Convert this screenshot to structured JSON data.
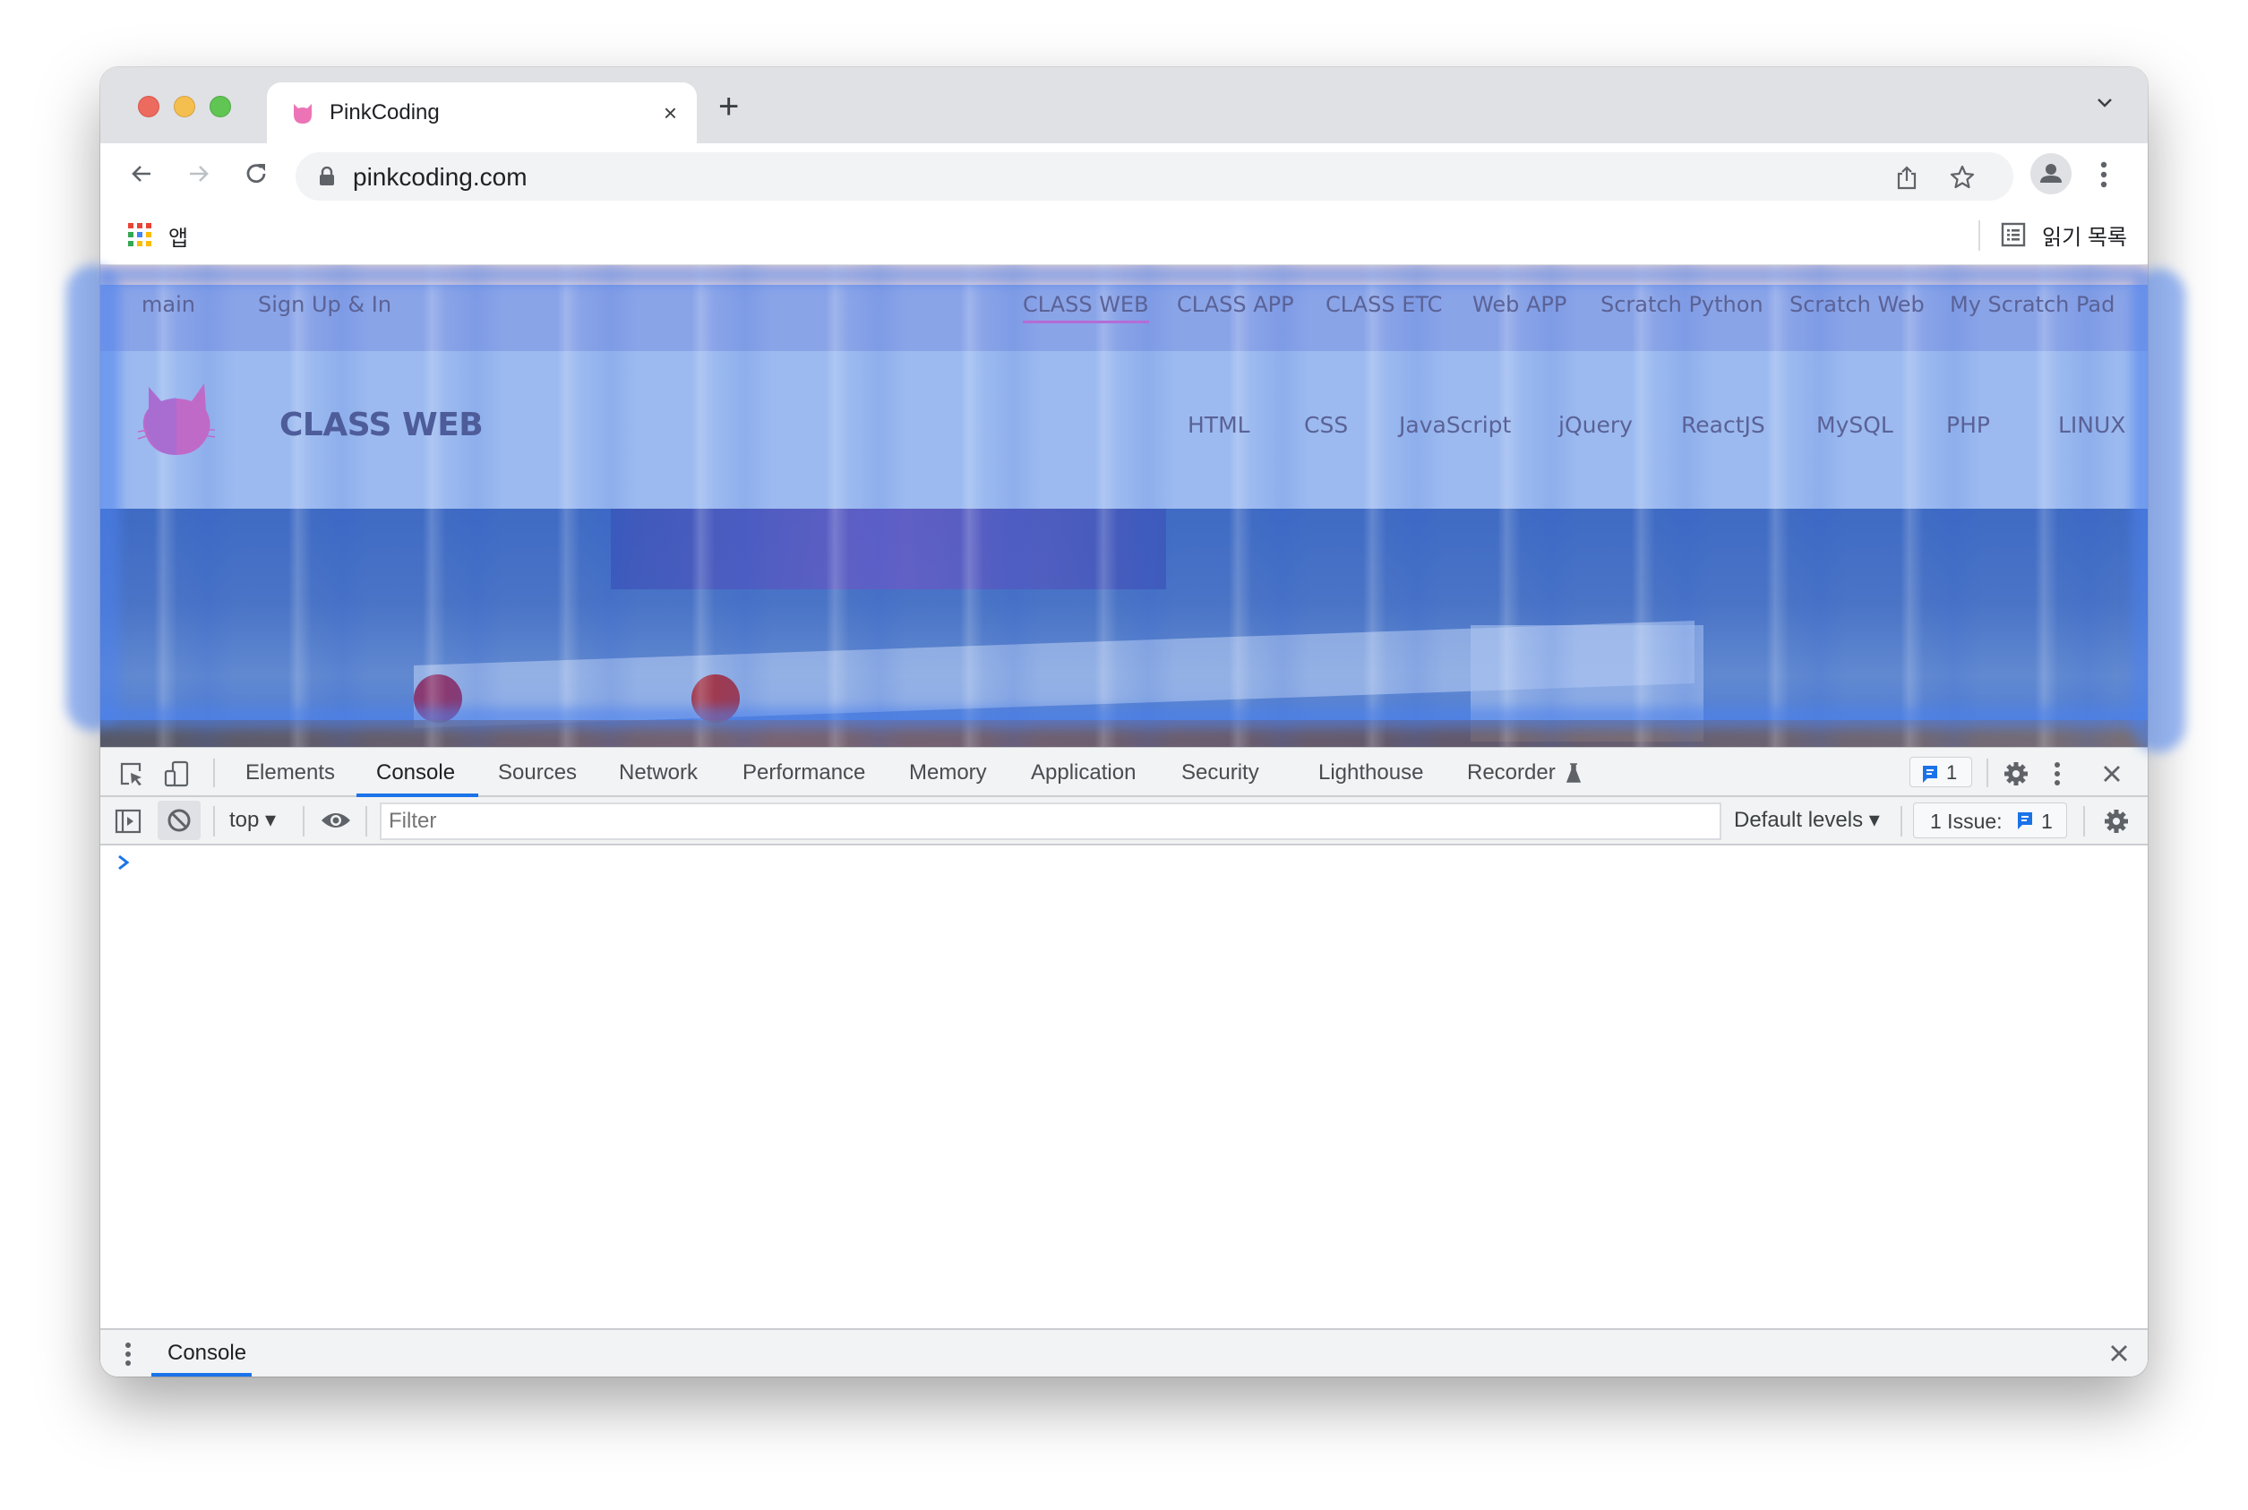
{
  "browser": {
    "tab": {
      "title": "PinkCoding",
      "favicon": "cat-face-icon",
      "close": "×"
    },
    "new_tab": "+",
    "address": {
      "url": "pinkcoding.com",
      "secure_icon": "lock-icon"
    },
    "bookmarks": {
      "apps_label": "앱",
      "reading_list_label": "읽기 목록"
    }
  },
  "site": {
    "top_nav_left": [
      {
        "label": "main"
      },
      {
        "label": "Sign Up & In"
      }
    ],
    "top_nav_right": [
      {
        "label": "CLASS WEB",
        "active": true
      },
      {
        "label": "CLASS APP"
      },
      {
        "label": "CLASS ETC"
      },
      {
        "label": "Web APP"
      },
      {
        "label": "Scratch Python"
      },
      {
        "label": "Scratch Web"
      },
      {
        "label": "My Scratch Pad"
      }
    ],
    "title": "CLASS WEB",
    "header_nav": [
      {
        "label": "HTML"
      },
      {
        "label": "CSS"
      },
      {
        "label": "JavaScript"
      },
      {
        "label": "jQuery"
      },
      {
        "label": "ReactJS"
      },
      {
        "label": "MySQL"
      },
      {
        "label": "PHP"
      },
      {
        "label": "LINUX"
      }
    ],
    "colors": {
      "logo_pink": "#c06ac8",
      "accent_underline": "#b46cd6",
      "scribble_blue": "#4c82ec"
    }
  },
  "devtools": {
    "tabs": [
      {
        "label": "Elements"
      },
      {
        "label": "Console",
        "active": true
      },
      {
        "label": "Sources"
      },
      {
        "label": "Network"
      },
      {
        "label": "Performance"
      },
      {
        "label": "Memory"
      },
      {
        "label": "Application"
      },
      {
        "label": "Security"
      },
      {
        "label": "Lighthouse"
      },
      {
        "label": "Recorder"
      }
    ],
    "issues_badge_count": "1",
    "toolbar": {
      "context": "top",
      "filter_placeholder": "Filter",
      "levels": "Default levels",
      "issues_label": "1 Issue:",
      "issues_count": "1"
    },
    "prompt_symbol": ">",
    "drawer": {
      "tab": "Console"
    },
    "accent": "#1a73e8"
  }
}
